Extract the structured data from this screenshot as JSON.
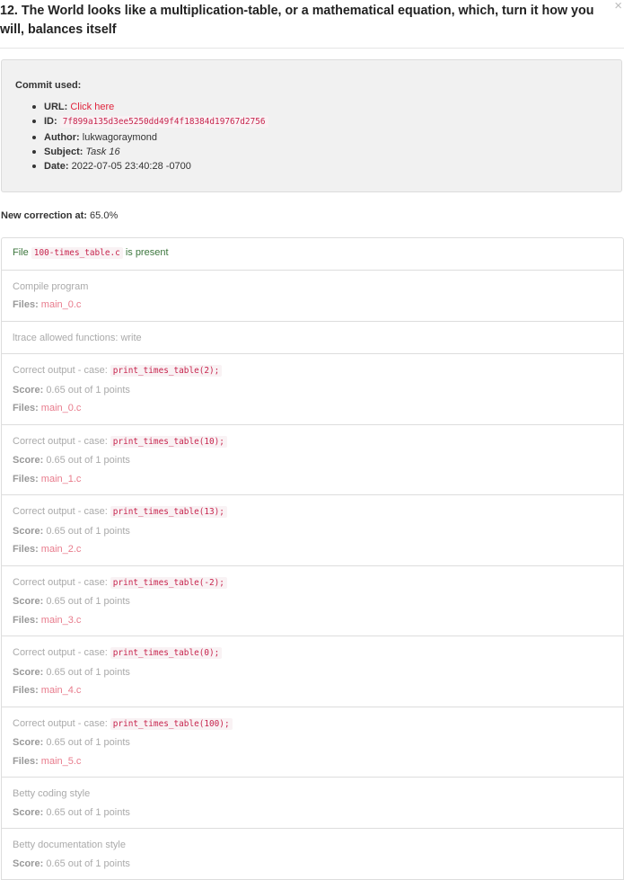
{
  "task": {
    "title": "12. The World looks like a multiplication-table, or a mathematical equation, which, turn it how you will, balances itself",
    "close_symbol": "×"
  },
  "commit": {
    "heading": "Commit used:",
    "url_label": "URL:",
    "url_text": "Click here",
    "id_label": "ID:",
    "id_value": "7f899a135d3ee5250dd49f4f18384d19767d2756",
    "author_label": "Author:",
    "author_value": "lukwagoraymond",
    "subject_label": "Subject:",
    "subject_value": "Task 16",
    "date_label": "Date:",
    "date_value": "2022-07-05 23:40:28 -0700"
  },
  "correction": {
    "label": "New correction at:",
    "value": "65.0%"
  },
  "labels": {
    "files": "Files:",
    "score": "Score:",
    "correct_output_prefix": "Correct output - case:"
  },
  "file_check": {
    "prefix": "File",
    "filename": "100-times_table.c",
    "suffix": "is present"
  },
  "compile": {
    "title": "Compile program",
    "files": "main_0.c"
  },
  "ltrace": {
    "title": "ltrace allowed functions: write"
  },
  "cases": [
    {
      "code": "print_times_table(2);",
      "score": "0.65 out of 1 points",
      "files": "main_0.c"
    },
    {
      "code": "print_times_table(10);",
      "score": "0.65 out of 1 points",
      "files": "main_1.c"
    },
    {
      "code": "print_times_table(13);",
      "score": "0.65 out of 1 points",
      "files": "main_2.c"
    },
    {
      "code": "print_times_table(-2);",
      "score": "0.65 out of 1 points",
      "files": "main_3.c"
    },
    {
      "code": "print_times_table(0);",
      "score": "0.65 out of 1 points",
      "files": "main_4.c"
    },
    {
      "code": "print_times_table(100);",
      "score": "0.65 out of 1 points",
      "files": "main_5.c"
    }
  ],
  "betty_style": {
    "title": "Betty coding style",
    "score": "0.65 out of 1 points"
  },
  "betty_doc": {
    "title": "Betty documentation style",
    "score": "0.65 out of 1 points"
  },
  "colors": {
    "link": "#e0253d",
    "code_text": "#c7254e",
    "code_bg": "#f9f2f4",
    "success": "#3c763d",
    "muted": "#aaaaaa",
    "files_value": "#e87b8c"
  }
}
